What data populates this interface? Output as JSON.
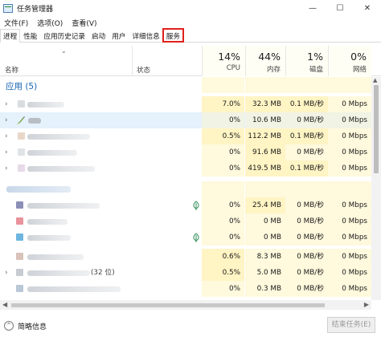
{
  "window": {
    "title": "任务管理器",
    "minimize": "—",
    "maximize": "☐",
    "close": "✕"
  },
  "menu": [
    "文件(F)",
    "选项(O)",
    "查看(V)"
  ],
  "tabs": [
    "进程",
    "性能",
    "应用历史记录",
    "启动",
    "用户",
    "详细信息",
    "服务"
  ],
  "columns": {
    "name": "名称",
    "status": "状态",
    "cpu": {
      "pct": "14%",
      "label": "CPU"
    },
    "memory": {
      "pct": "44%",
      "label": "内存"
    },
    "disk": {
      "pct": "1%",
      "label": "磁盘"
    },
    "network": {
      "pct": "0%",
      "label": "网络"
    }
  },
  "group": {
    "title": "应用 (5)"
  },
  "rows": [
    {
      "cpu": "7.0%",
      "mem": "32.3 MB",
      "disk": "0.1 MB/秒",
      "net": "0 Mbps"
    },
    {
      "cpu": "0%",
      "mem": "10.6 MB",
      "disk": "0 MB/秒",
      "net": "0 Mbps"
    },
    {
      "cpu": "0.5%",
      "mem": "112.2 MB",
      "disk": "0.1 MB/秒",
      "net": "0 Mbps"
    },
    {
      "cpu": "0%",
      "mem": "91.6 MB",
      "disk": "0 MB/秒",
      "net": "0 Mbps"
    },
    {
      "cpu": "0%",
      "mem": "419.5 MB",
      "disk": "0.1 MB/秒",
      "net": "0 Mbps"
    },
    {
      "cpu": "",
      "mem": "",
      "disk": "",
      "net": ""
    },
    {
      "cpu": "0%",
      "mem": "25.4 MB",
      "disk": "0 MB/秒",
      "net": "0 Mbps"
    },
    {
      "cpu": "0%",
      "mem": "0 MB",
      "disk": "0 MB/秒",
      "net": "0 Mbps"
    },
    {
      "cpu": "0%",
      "mem": "0 MB",
      "disk": "0 MB/秒",
      "net": "0 Mbps"
    },
    {
      "cpu": "0.6%",
      "mem": "8.3 MB",
      "disk": "0 MB/秒",
      "net": "0 Mbps"
    },
    {
      "cpu": "0.5%",
      "mem": "5.0 MB",
      "disk": "0 MB/秒",
      "net": "0 Mbps"
    },
    {
      "cpu": "0%",
      "mem": "0.3 MB",
      "disk": "0 MB/秒",
      "net": "0 Mbps"
    },
    {
      "cpu": "",
      "mem": "",
      "disk": "",
      "net": ""
    }
  ],
  "group_count_fragment": "(32 位)",
  "footer": {
    "fewer_details": "简略信息",
    "end_task": "结束任务(E)"
  },
  "colors": {
    "highlight_outline": "#e0201b",
    "group_title": "#1464b4",
    "heat": "#fff4c4",
    "selected_row": "#e5f1fb"
  }
}
